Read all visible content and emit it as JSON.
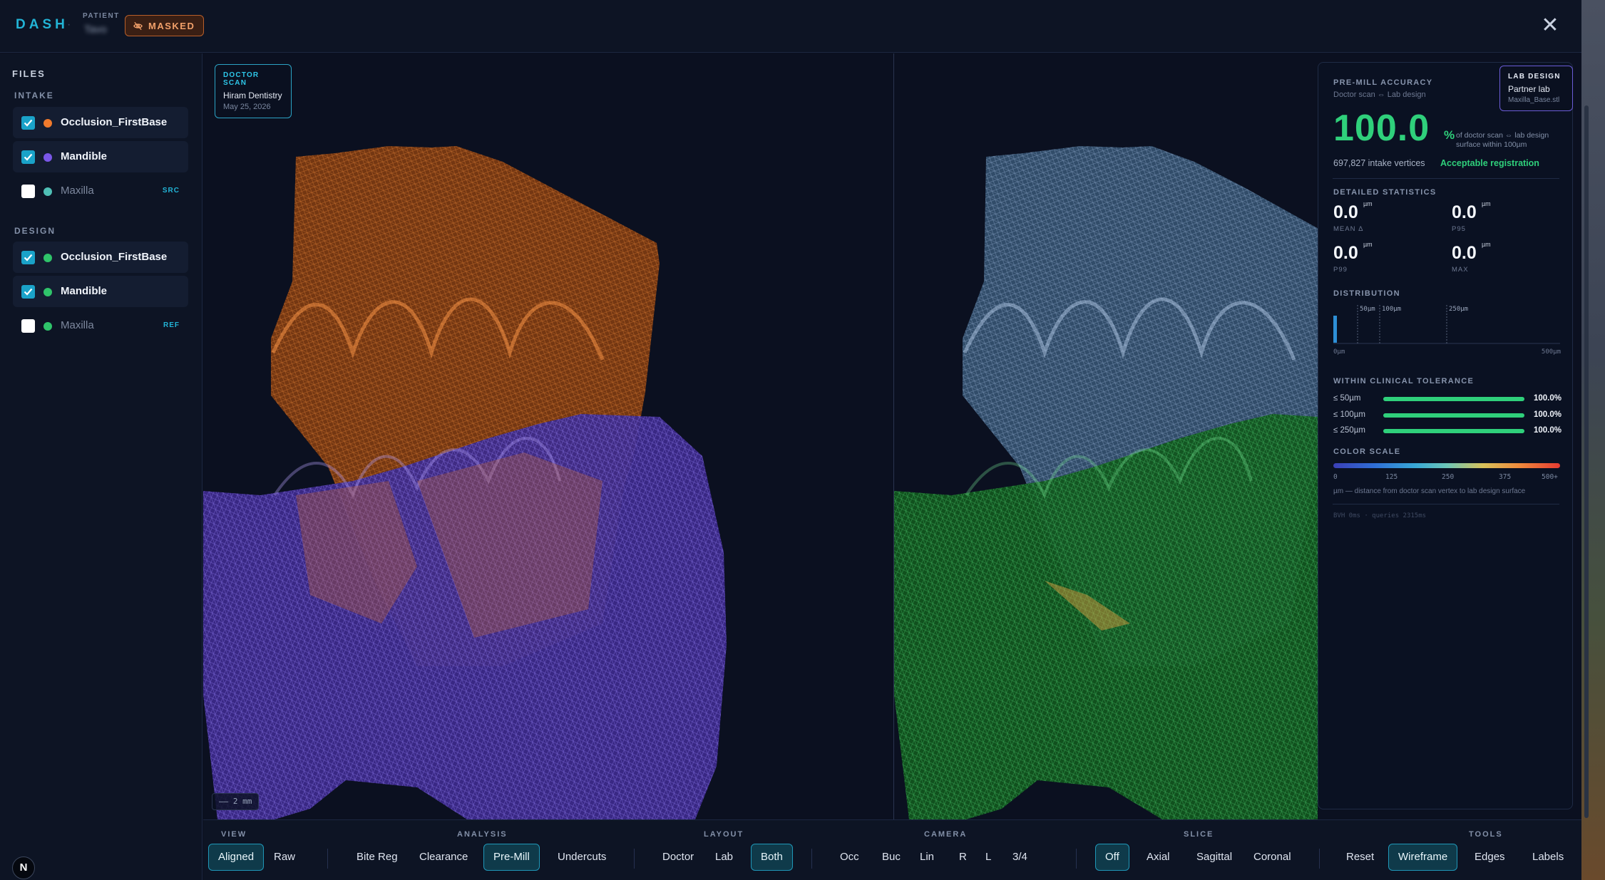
{
  "header": {
    "brand": "DASH",
    "separator": "·",
    "patient_label": "PATIENT",
    "patient_name": "Tavo",
    "masked_label": "MASKED",
    "close_symbol": "✕"
  },
  "sidebar": {
    "title": "FILES",
    "groups": [
      {
        "title": "INTAKE",
        "items": [
          {
            "label": "Occlusion_FirstBase",
            "checked": true,
            "color": "#f07a2c",
            "tag": ""
          },
          {
            "label": "Mandible",
            "checked": true,
            "color": "#7a57e8",
            "tag": ""
          },
          {
            "label": "Maxilla",
            "checked": false,
            "color": "#4fbfb5",
            "tag": "SRC"
          }
        ]
      },
      {
        "title": "DESIGN",
        "items": [
          {
            "label": "Occlusion_FirstBase",
            "checked": true,
            "color": "#2fc46a",
            "tag": ""
          },
          {
            "label": "Mandible",
            "checked": true,
            "color": "#2fc46a",
            "tag": ""
          },
          {
            "label": "Maxilla",
            "checked": false,
            "color": "#2fc46a",
            "tag": "REF"
          }
        ]
      }
    ],
    "avatar_letter": "N"
  },
  "viewport": {
    "doctor_card": {
      "kind": "DOCTOR SCAN",
      "name": "Hiram Dentistry",
      "date": "May 25, 2026"
    },
    "lab_card": {
      "kind": "LAB DESIGN",
      "name": "Partner lab",
      "file": "Maxilla_Base.stl"
    },
    "scale_bar": "—— 2 mm"
  },
  "accuracy": {
    "title": "PRE-MILL ACCURACY",
    "subtitle": "Doctor scan ⇔ Lab design",
    "percent": "100.0",
    "percent_sign": "%",
    "percent_note": "of doctor scan ⇔ lab design surface within 100µm",
    "vertices": "697,827 intake vertices",
    "status": "Acceptable registration",
    "status_color": "#2fd07b",
    "detailed_title": "DETAILED STATISTICS",
    "stats": [
      {
        "value": "0.0",
        "unit": "µm",
        "label": "MEAN Δ"
      },
      {
        "value": "0.0",
        "unit": "µm",
        "label": "P95"
      },
      {
        "value": "0.0",
        "unit": "µm",
        "label": "P99"
      },
      {
        "value": "0.0",
        "unit": "µm",
        "label": "MAX"
      }
    ],
    "distribution_title": "DISTRIBUTION",
    "distribution": {
      "markers": [
        "50µm",
        "100µm",
        "250µm"
      ],
      "axis_min": "0µm",
      "axis_max": "500µm"
    },
    "tolerance_title": "WITHIN CLINICAL TOLERANCE",
    "tolerance": [
      {
        "label": "≤ 50µm",
        "value": "100.0%",
        "fraction": 1.0
      },
      {
        "label": "≤ 100µm",
        "value": "100.0%",
        "fraction": 1.0
      },
      {
        "label": "≤ 250µm",
        "value": "100.0%",
        "fraction": 1.0
      }
    ],
    "color_scale_title": "COLOR SCALE",
    "color_scale_ticks": [
      "0",
      "125",
      "250",
      "375",
      "500+"
    ],
    "color_scale_note": "µm — distance from doctor scan vertex to lab design surface",
    "perf_note": "BVH 0ms · queries 2315ms"
  },
  "toolbar": {
    "view": {
      "label": "VIEW",
      "buttons": [
        "Aligned",
        "Raw"
      ],
      "active": "Aligned"
    },
    "analysis": {
      "label": "ANALYSIS",
      "buttons": [
        "Bite Reg",
        "Clearance",
        "Pre-Mill",
        "Undercuts"
      ],
      "active": "Pre-Mill"
    },
    "layout": {
      "label": "LAYOUT",
      "buttons": [
        "Doctor",
        "Lab",
        "Both"
      ],
      "active": "Both"
    },
    "camera": {
      "label": "CAMERA",
      "buttons": [
        "Occ",
        "Buc",
        "Lin",
        "R",
        "L",
        "3/4"
      ],
      "active": ""
    },
    "slice": {
      "label": "SLICE",
      "buttons": [
        "Off",
        "Axial",
        "Sagittal",
        "Coronal"
      ],
      "active": "Off"
    },
    "tools": {
      "label": "TOOLS",
      "buttons": [
        "Reset",
        "Wireframe",
        "Edges",
        "Labels"
      ],
      "active": "Wireframe"
    }
  },
  "colors": {
    "accent": "#22b4d6",
    "doctor_upper": "#d86a1e",
    "doctor_lower": "#6b4fd8",
    "lab_upper": "#6f8fb8",
    "lab_lower": "#23a84a"
  }
}
